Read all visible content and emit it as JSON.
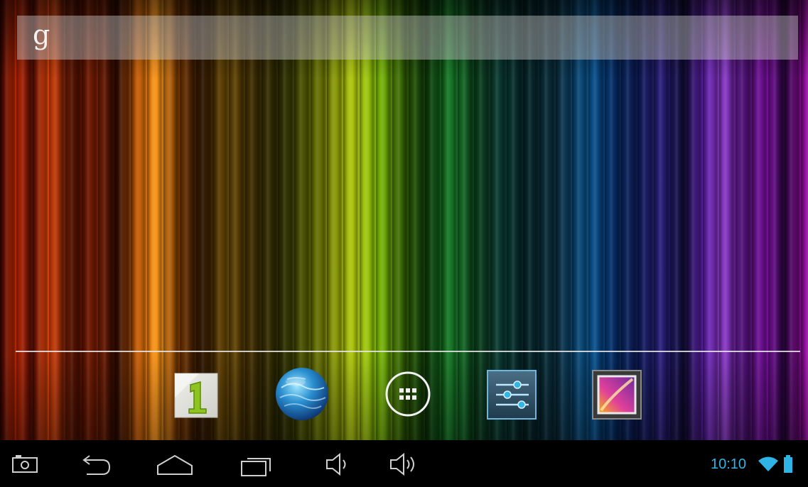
{
  "search_bar": {
    "logo_text": "g"
  },
  "dock": {
    "apps": [
      {
        "name": "1mobile-market-icon"
      },
      {
        "name": "browser-globe-icon"
      },
      {
        "name": "all-apps-icon"
      },
      {
        "name": "settings-icon"
      },
      {
        "name": "gallery-icon"
      }
    ]
  },
  "status_bar": {
    "time": "10:10",
    "accent_color": "#2fb4e6"
  },
  "nav_buttons": [
    "screenshot-icon",
    "back-icon",
    "home-icon",
    "recent-apps-icon",
    "volume-down-icon",
    "volume-up-icon"
  ]
}
